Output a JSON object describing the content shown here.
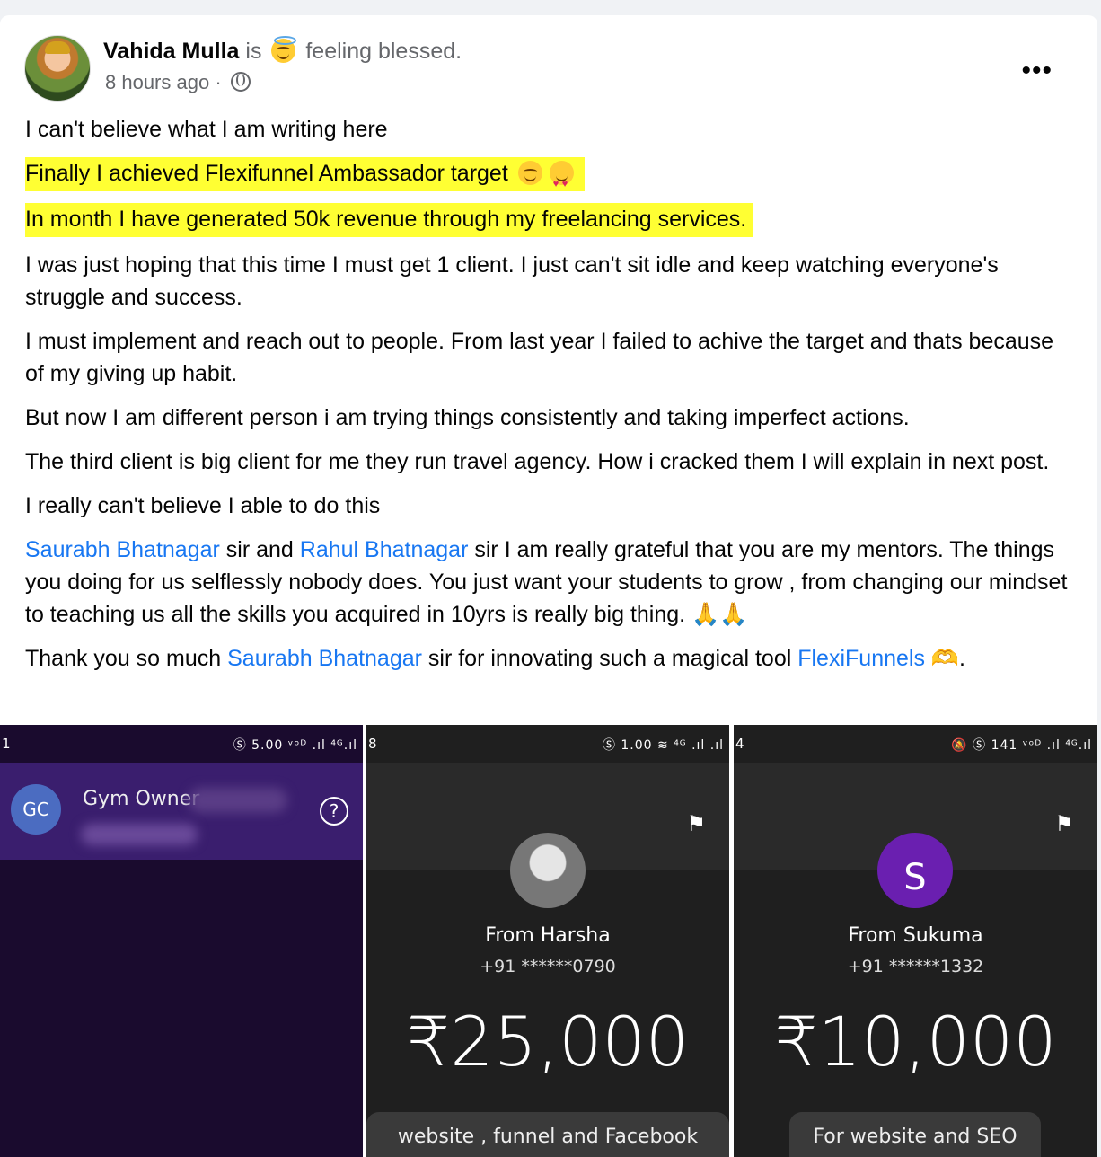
{
  "post": {
    "author": "Vahida Mulla",
    "is_text": "is",
    "feeling": "feeling blessed.",
    "time": "8 hours ago",
    "separator": "·",
    "more": "•••",
    "lines": {
      "p1": "I can't believe what I am writing here",
      "p2": "Finally I achieved Flexifunnel Ambassador target",
      "p3": "In month I have generated 50k revenue through my freelancing services.",
      "p4": "I was just hoping that this time I must get 1 client. I just can't sit idle and keep watching everyone's struggle and success.",
      "p5": "I must implement and reach out to people. From last year I failed to achive the target and thats because of my giving up habit.",
      "p6": "But now I am different person i am trying things consistently and taking imperfect actions.",
      "p7": "The third client is big client for me they run travel agency. How i cracked them I will explain in next post.",
      "p8": "I really can't believe I able to do this",
      "p9_link1": "Saurabh Bhatnagar",
      "p9_t1": " sir and ",
      "p9_link2": "Rahul Bhatnagar",
      "p9_t2": " sir I am really grateful that you are my mentors. The things you doing for us selflessly nobody does. You just want your students to grow , from changing our mindset to teaching us all the skills you acquired in 10yrs is really big thing. 🙏🙏",
      "p10_t1": "Thank you so much ",
      "p10_link1": "Saurabh Bhatnagar",
      "p10_t2": " sir for innovating such a magical tool ",
      "p10_link2": "FlexiFunnels",
      "p10_t3": " 🫶."
    }
  },
  "gallery": [
    {
      "status_num": "1",
      "status_icons": "Ⓢ 5.00 ᵛᵒᴰ .ıl ⁴ᴳ.ıl",
      "avatar": "GC",
      "name": "Gym Owner",
      "help": "?"
    },
    {
      "status_num": "8",
      "status_icons": "Ⓢ 1.00 ≋ ⁴ᴳ .ıl .ıl",
      "flag": "⚑",
      "from": "From Harsha",
      "phone": "+91 ******0790",
      "amount": "₹25,000",
      "note": "website , funnel and Facebook"
    },
    {
      "status_num": "4",
      "status_icons": "🔕 Ⓢ 141 ᵛᵒᴰ .ıl ⁴ᴳ.ıl",
      "flag": "⚑",
      "avatar": "S",
      "from": "From Sukuma",
      "phone": "+91 ******1332",
      "amount": "₹10,000",
      "note": "For website and SEO"
    }
  ]
}
